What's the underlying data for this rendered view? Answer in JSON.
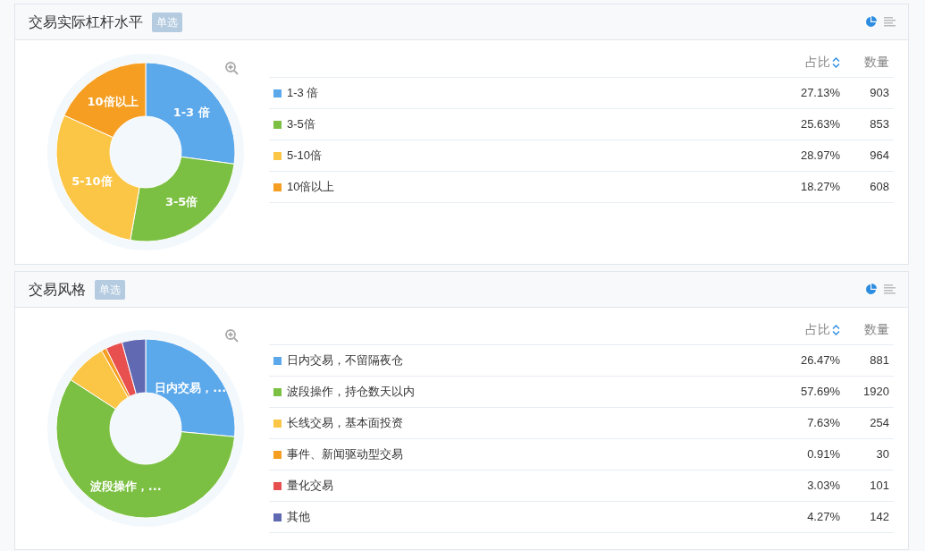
{
  "panels": [
    {
      "title": "交易实际杠杆水平",
      "badge": "单选",
      "columns": [
        "占比",
        "数量"
      ],
      "rows": [
        {
          "share": "27.13%",
          "count": "903",
          "color": "#5ba8eb"
        },
        {
          "share": "25.63%",
          "count": "853",
          "color": "#7bc043"
        },
        {
          "share": "28.97%",
          "count": "964",
          "color": "#fbc546"
        },
        {
          "share": "18.27%",
          "count": "608",
          "color": "#f59e21"
        }
      ],
      "slice_labels": [
        "1-3 倍",
        "3-5倍",
        "5-10倍",
        "10倍以上"
      ],
      "chart_data": {
        "type": "donut",
        "categories": [
          "1-3 倍",
          "3-5倍",
          "5-10倍",
          "10倍以上"
        ],
        "values": [
          27.13,
          25.63,
          28.97,
          18.27
        ]
      }
    },
    {
      "title": "交易风格",
      "badge": "单选",
      "columns": [
        "占比",
        "数量"
      ],
      "rows": [
        {
          "share": "26.47%",
          "count": "881",
          "color": "#5ba8eb"
        },
        {
          "share": "57.69%",
          "count": "1920",
          "color": "#7bc043"
        },
        {
          "share": "7.63%",
          "count": "254",
          "color": "#fbc546"
        },
        {
          "share": "0.91%",
          "count": "30",
          "color": "#f59e21"
        },
        {
          "share": "3.03%",
          "count": "101",
          "color": "#e84f4f"
        },
        {
          "share": "4.27%",
          "count": "142",
          "color": "#6269b3"
        }
      ],
      "slice_labels": [
        "日内交易，...",
        "波段操作，..."
      ],
      "chart_data": {
        "type": "donut",
        "categories": [
          "日内交易，不留隔夜仓",
          "波段操作，持仓数天以内",
          "长线交易，基本面投资",
          "事件、新闻驱动型交易",
          "量化交易",
          "其他"
        ],
        "values": [
          26.47,
          57.69,
          7.63,
          0.91,
          3.03,
          4.27
        ]
      }
    }
  ]
}
